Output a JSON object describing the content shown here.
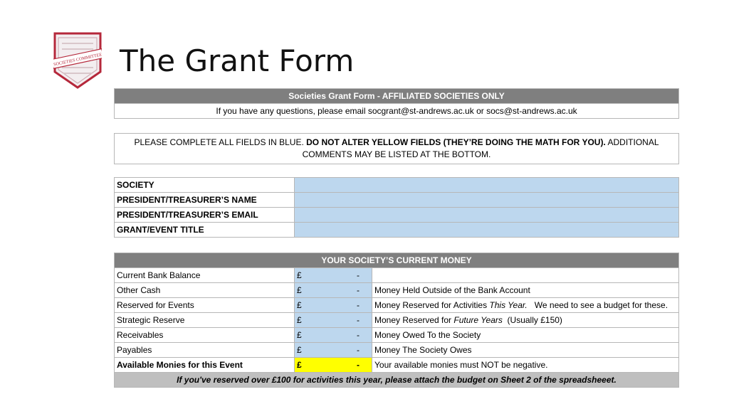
{
  "slide": {
    "title": "The Grant Form"
  },
  "logo": {
    "text": "SOCIETIES COMMITTEE"
  },
  "header": {
    "title": "Societies Grant Form - AFFILIATED SOCIETIES ONLY",
    "contact": "If you have any questions, please email socgrant@st-andrews.ac.uk or socs@st-andrews.ac.uk"
  },
  "instructions": {
    "part1": "PLEASE COMPLETE ALL FIELDS IN BLUE. ",
    "bold": "DO NOT ALTER YELLOW FIELDS (THEY’RE DOING THE MATH FOR YOU).",
    "part2": " ADDITIONAL COMMENTS MAY BE LISTED AT THE BOTTOM."
  },
  "details": {
    "rows": [
      {
        "label": "SOCIETY",
        "value": ""
      },
      {
        "label": "PRESIDENT/TREASURER’S NAME",
        "value": ""
      },
      {
        "label": "PRESIDENT/TREASURER’S EMAIL",
        "value": ""
      },
      {
        "label": "GRANT/EVENT TITLE",
        "value": ""
      }
    ]
  },
  "money": {
    "title": "YOUR SOCIETY’S CURRENT MONEY",
    "currency": "£",
    "dash": "-",
    "rows": [
      {
        "label": "Current Bank Balance",
        "note_a": "",
        "note_i": "",
        "note_b": ""
      },
      {
        "label": "Other Cash",
        "note_a": "Money Held Outside of the Bank Account",
        "note_i": "",
        "note_b": ""
      },
      {
        "label": "Reserved for Events",
        "note_a": "Money Reserved for Activities ",
        "note_i": "This Year.",
        "note_b": "   We need to see a budget for these."
      },
      {
        "label": "Strategic Reserve",
        "note_a": "Money Reserved for ",
        "note_i": "Future Years",
        "note_b": "  (Usually £150)"
      },
      {
        "label": "Receivables",
        "note_a": "Money Owed To the Society",
        "note_i": "",
        "note_b": ""
      },
      {
        "label": "Payables",
        "note_a": "Money The Society Owes",
        "note_i": "",
        "note_b": ""
      },
      {
        "label": "Available Monies for this Event",
        "note_a": "Your available monies must NOT be negative.",
        "note_i": "",
        "note_b": ""
      }
    ],
    "footer": "If you've reserved over £100 for activities this year, please attach the budget on Sheet 2 of the spreadsheeet."
  }
}
